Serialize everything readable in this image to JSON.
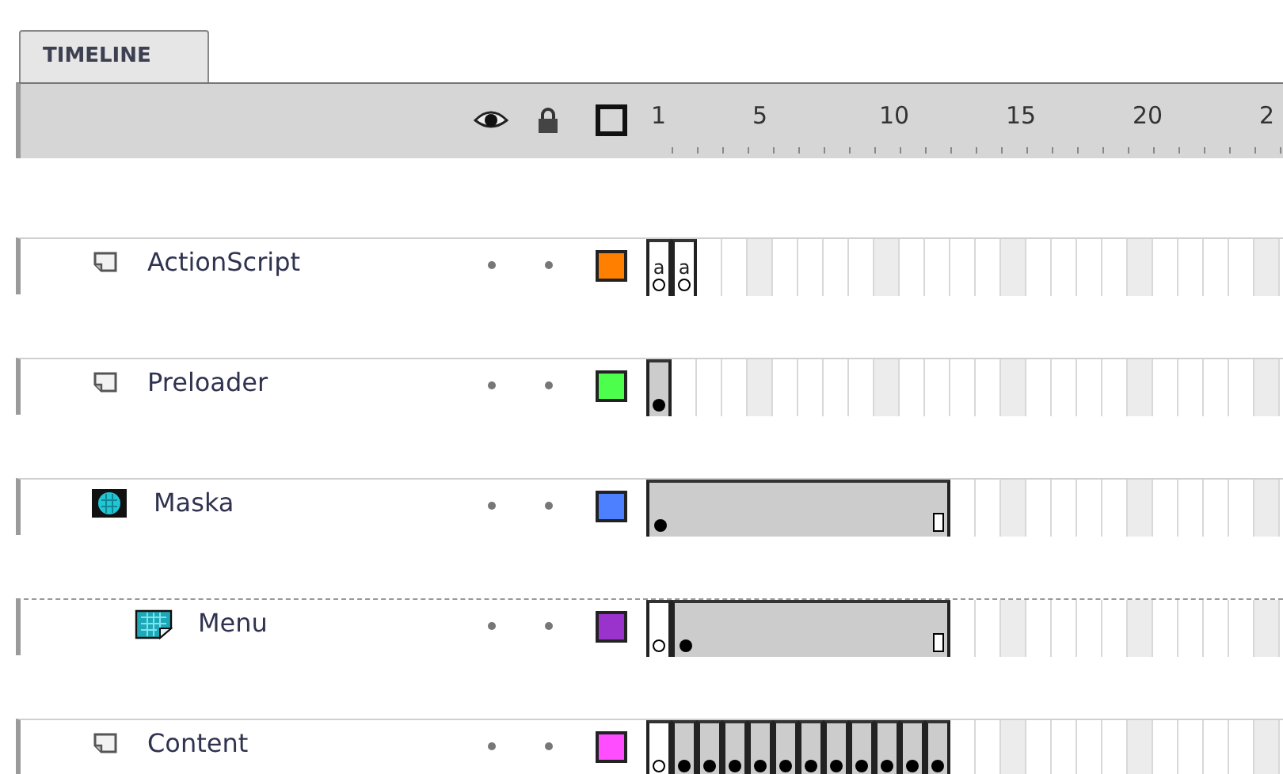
{
  "tab": {
    "label": "TIMELINE",
    "selected": true
  },
  "ruler": [
    "1",
    "5",
    "10",
    "15",
    "20",
    "2"
  ],
  "layers": [
    {
      "name": "ActionScript",
      "kind": "normal",
      "color": "#ff8000",
      "hidden": false,
      "locked": false,
      "frames": [
        {
          "kind": "blank_keyframe",
          "script": "a"
        },
        {
          "kind": "blank_keyframe",
          "script": "a"
        }
      ]
    },
    {
      "name": "Preloader",
      "kind": "normal",
      "color": "#4dff4d",
      "hidden": false,
      "locked": false,
      "frames": [
        {
          "kind": "keyframe"
        }
      ]
    },
    {
      "name": "Maska",
      "kind": "mask",
      "color": "#4d80ff",
      "hidden": false,
      "locked": false,
      "frames": [
        {
          "kind": "keyframe"
        },
        {
          "kind": "span"
        },
        {
          "kind": "span"
        },
        {
          "kind": "span"
        },
        {
          "kind": "span"
        },
        {
          "kind": "span"
        },
        {
          "kind": "span"
        },
        {
          "kind": "span"
        },
        {
          "kind": "span"
        },
        {
          "kind": "span"
        },
        {
          "kind": "span"
        },
        {
          "kind": "span_end"
        }
      ],
      "children": [
        {
          "name": "Menu",
          "kind": "masked",
          "color": "#9933cc",
          "hidden": false,
          "locked": false,
          "frames": [
            {
              "kind": "blank_keyframe"
            },
            {
              "kind": "keyframe"
            },
            {
              "kind": "span"
            },
            {
              "kind": "span"
            },
            {
              "kind": "span"
            },
            {
              "kind": "span"
            },
            {
              "kind": "span"
            },
            {
              "kind": "span"
            },
            {
              "kind": "span"
            },
            {
              "kind": "span"
            },
            {
              "kind": "span"
            },
            {
              "kind": "span_end"
            }
          ]
        }
      ]
    },
    {
      "name": "Content",
      "kind": "normal",
      "color": "#ff4dff",
      "hidden": false,
      "locked": false,
      "frames": [
        {
          "kind": "blank_keyframe"
        },
        {
          "kind": "keyframe"
        },
        {
          "kind": "keyframe"
        },
        {
          "kind": "keyframe"
        },
        {
          "kind": "keyframe"
        },
        {
          "kind": "keyframe"
        },
        {
          "kind": "keyframe"
        },
        {
          "kind": "keyframe"
        },
        {
          "kind": "keyframe"
        },
        {
          "kind": "keyframe"
        },
        {
          "kind": "keyframe"
        },
        {
          "kind": "keyframe"
        }
      ]
    }
  ]
}
